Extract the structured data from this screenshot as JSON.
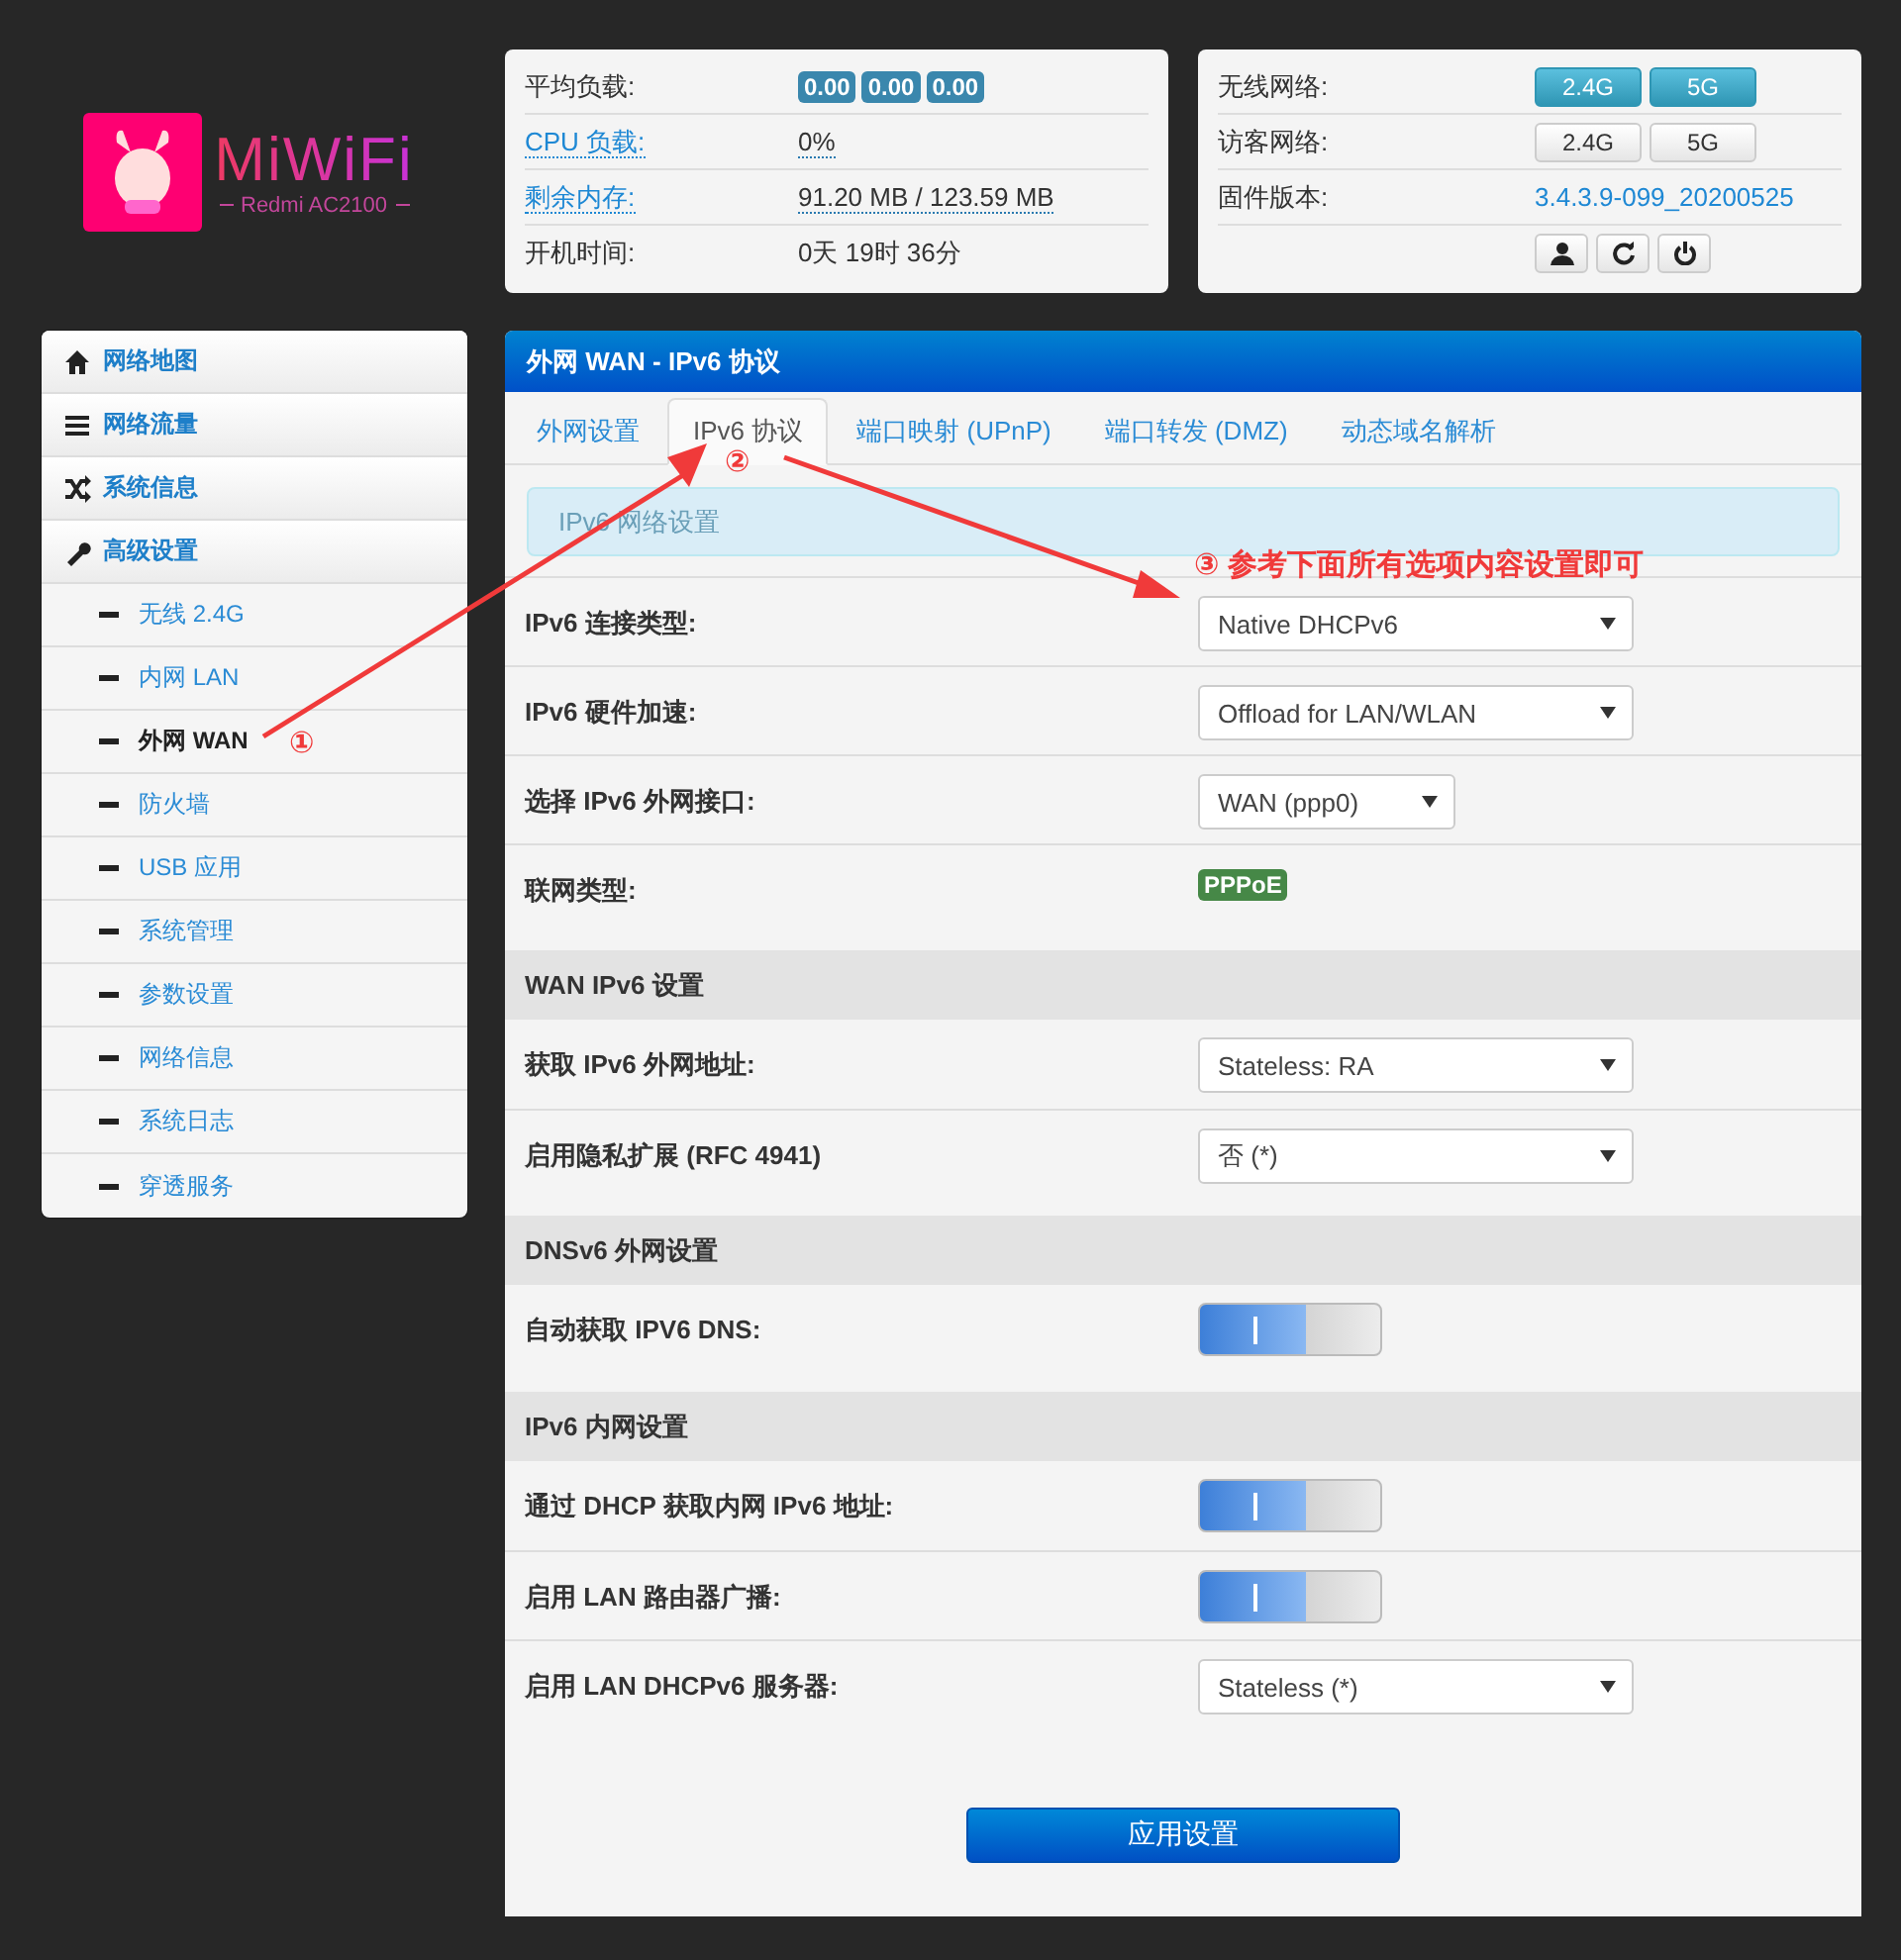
{
  "logo": {
    "brand": "MiWiFi",
    "model": "Redmi AC2100"
  },
  "status": [
    {
      "label": "平均负载:",
      "kind": "badges",
      "values": [
        "0.00",
        "0.00",
        "0.00"
      ]
    },
    {
      "label": "CPU 负载:",
      "kind": "dotted",
      "link": true,
      "value": "0%"
    },
    {
      "label": "剩余内存:",
      "kind": "dotted",
      "link": true,
      "value": "91.20 MB / 123.59 MB"
    },
    {
      "label": "开机时间:",
      "kind": "plain",
      "link": false,
      "value": "0天 19时 36分"
    }
  ],
  "network": [
    {
      "label": "无线网络:",
      "kind": "toggles",
      "buttons": [
        {
          "label": "2.4G",
          "on": true
        },
        {
          "label": "5G",
          "on": true
        }
      ]
    },
    {
      "label": "访客网络:",
      "kind": "toggles",
      "buttons": [
        {
          "label": "2.4G",
          "on": false
        },
        {
          "label": "5G",
          "on": false
        }
      ]
    },
    {
      "label": "固件版本:",
      "kind": "link",
      "value": "3.4.3.9-099_20200525"
    },
    {
      "kind": "actions"
    }
  ],
  "sidebar": [
    {
      "label": "网络地图",
      "selected": false
    },
    {
      "label": "网络流量",
      "selected": false
    },
    {
      "label": "系统信息",
      "selected": false
    },
    {
      "label": "高级设置",
      "selected": false,
      "children": [
        {
          "label": "无线 2.4G",
          "selected": false
        },
        {
          "label": "内网 LAN",
          "selected": false
        },
        {
          "label": "外网 WAN",
          "selected": true
        },
        {
          "label": "防火墙",
          "selected": false
        },
        {
          "label": "USB 应用",
          "selected": false
        },
        {
          "label": "系统管理",
          "selected": false
        },
        {
          "label": "参数设置",
          "selected": false
        },
        {
          "label": "网络信息",
          "selected": false
        },
        {
          "label": "系统日志",
          "selected": false
        },
        {
          "label": "穿透服务",
          "selected": false
        }
      ]
    }
  ],
  "panel": {
    "title": "外网 WAN - IPv6 协议",
    "tabs": [
      {
        "label": "外网设置",
        "selected": false
      },
      {
        "label": "IPv6 协议",
        "selected": true
      },
      {
        "label": "端口映射 (UPnP)",
        "selected": false
      },
      {
        "label": "端口转发 (DMZ)",
        "selected": false
      },
      {
        "label": "动态域名解析",
        "selected": false
      }
    ],
    "notice": "IPv6 网络设置",
    "sections": [
      {
        "rows": [
          {
            "label": "IPv6 连接类型:",
            "kind": "select",
            "value": "Native DHCPv6"
          },
          {
            "label": "IPv6 硬件加速:",
            "kind": "select",
            "value": "Offload for LAN/WLAN"
          },
          {
            "label": "选择 IPv6 外网接口:",
            "kind": "select_small",
            "value": "WAN (ppp0)"
          },
          {
            "label": "联网类型:",
            "kind": "badge",
            "value": "PPPoE"
          }
        ]
      },
      {
        "heading": "WAN IPv6 设置",
        "rows": [
          {
            "label": "获取 IPv6 外网地址:",
            "kind": "select",
            "value": "Stateless: RA"
          },
          {
            "label": "启用隐私扩展 (RFC 4941)",
            "kind": "select",
            "value": "否 (*)"
          }
        ]
      },
      {
        "heading": "DNSv6 外网设置",
        "rows": [
          {
            "label": "自动获取 IPV6 DNS:",
            "kind": "switch",
            "on": true
          }
        ]
      },
      {
        "heading": "IPv6 内网设置",
        "rows": [
          {
            "label": "通过 DHCP 获取内网 IPv6 地址:",
            "kind": "switch",
            "on": true
          },
          {
            "label": "启用 LAN 路由器广播:",
            "kind": "switch",
            "on": true
          },
          {
            "label": "启用 LAN DHCPv6 服务器:",
            "kind": "select",
            "value": "Stateless (*)"
          }
        ]
      }
    ],
    "apply_button": "应用设置"
  },
  "annotations": [
    {
      "text": "①"
    },
    {
      "text": "②"
    },
    {
      "text": "③ 参考下面所有选项内容设置即可"
    }
  ]
}
